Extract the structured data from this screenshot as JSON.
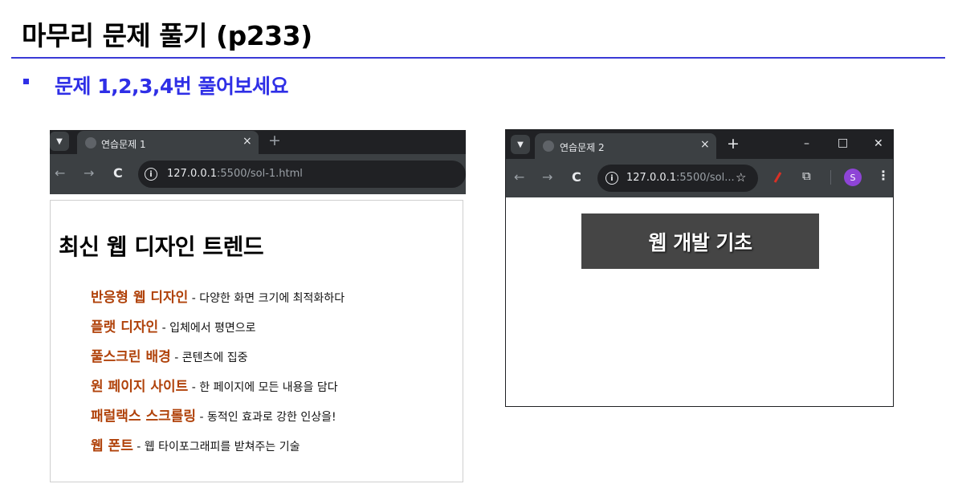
{
  "slide": {
    "title": "마무리 문제 풀기 (p233)",
    "bullet": "문제 1,2,3,4번 풀어보세요",
    "accent_color": "#2f2fe6"
  },
  "browser1": {
    "tab_menu_icon": "chevron-down-icon",
    "tab_title": "연습문제 1",
    "tab_close": "×",
    "new_tab": "+",
    "back": "←",
    "forward": "→",
    "reload": "C",
    "info": "i",
    "url_host": "127.0.0.1",
    "url_rest": ":5500/sol-1.html",
    "page": {
      "heading": "최신 웹 디자인 트렌드",
      "items": [
        {
          "term": "반응형 웹 디자인",
          "desc": " - 다양한 화면 크기에 최적화하다"
        },
        {
          "term": "플랫 디자인",
          "desc": " - 입체에서 평면으로"
        },
        {
          "term": "풀스크린 배경",
          "desc": " - 콘텐츠에 집중"
        },
        {
          "term": "원 페이지 사이트",
          "desc": " - 한 페이지에 모든 내용을 담다"
        },
        {
          "term": "패럴랙스 스크롤링",
          "desc": " - 동적인 효과로 강한 인상을!"
        },
        {
          "term": "웹 폰트",
          "desc": " - 웹 타이포그래피를 받쳐주는 기술"
        }
      ],
      "term_color": "#b0420a"
    }
  },
  "browser2": {
    "tab_title": "연습문제 2",
    "tab_close": "×",
    "new_tab": "+",
    "minimize": "–",
    "maximize": "□",
    "close": "✕",
    "back": "←",
    "forward": "→",
    "reload": "C",
    "info": "i",
    "url_host": "127.0.0.1",
    "url_rest": ":5500/sol...",
    "bookmark": "☆",
    "extensions": "⧉",
    "profile_initial": "S",
    "menu": "⋮",
    "page": {
      "banner": "웹 개발 기초",
      "banner_bg": "#454545"
    }
  }
}
